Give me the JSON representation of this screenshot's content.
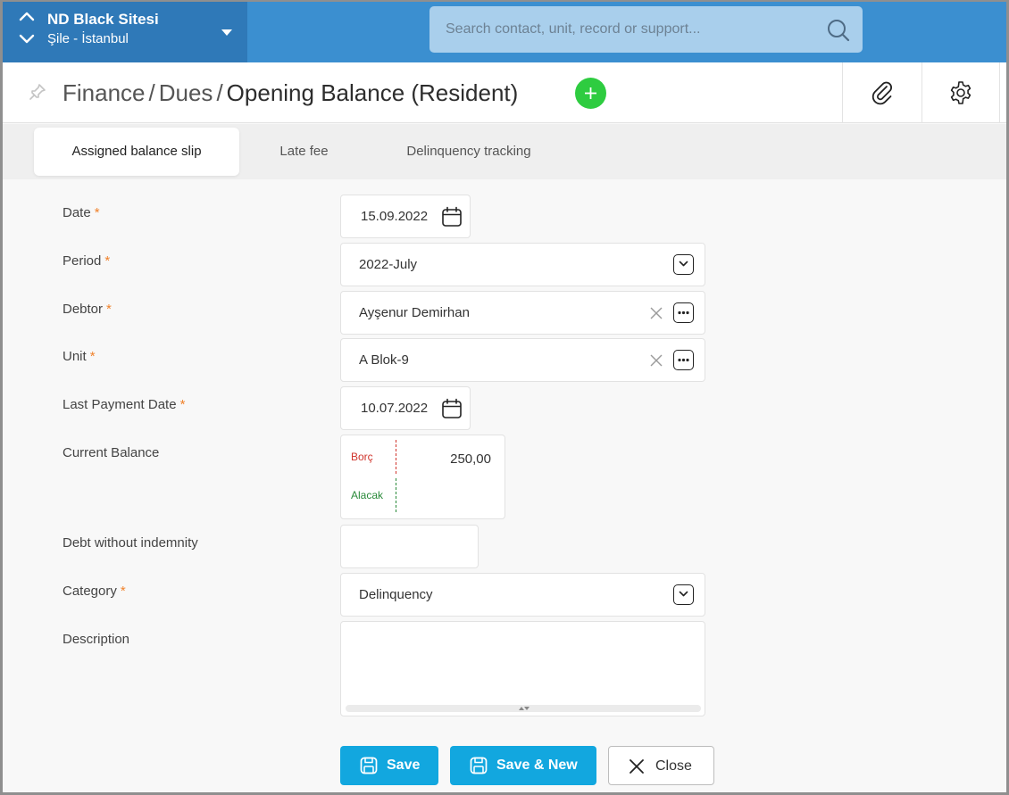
{
  "header": {
    "site_name": "ND Black Sitesi",
    "site_location": "Şile - İstanbul",
    "search_placeholder": "Search contact, unit, record or support..."
  },
  "titlebar": {
    "breadcrumb": [
      "Finance",
      "Dues"
    ],
    "current": "Opening Balance (Resident)"
  },
  "tabs": [
    {
      "label": "Assigned balance slip",
      "active": true
    },
    {
      "label": "Late fee",
      "active": false
    },
    {
      "label": "Delinquency tracking",
      "active": false
    }
  ],
  "form": {
    "date": {
      "label": "Date",
      "required": "*",
      "value": "15.09.2022"
    },
    "period": {
      "label": "Period",
      "required": "*",
      "value": "2022-July"
    },
    "debtor": {
      "label": "Debtor",
      "required": "*",
      "value": "Ayşenur Demirhan"
    },
    "unit": {
      "label": "Unit",
      "required": "*",
      "value": "A Blok-9"
    },
    "last_payment_date": {
      "label": "Last Payment Date",
      "required": "*",
      "value": "10.07.2022"
    },
    "current_balance": {
      "label": "Current Balance",
      "debt_label": "Borç",
      "credit_label": "Alacak",
      "debt_value": "250,00",
      "credit_value": ""
    },
    "debt_without_indemnity": {
      "label": "Debt without indemnity",
      "value": ""
    },
    "category": {
      "label": "Category",
      "required": "*",
      "value": "Delinquency"
    },
    "description": {
      "label": "Description",
      "value": ""
    }
  },
  "buttons": {
    "save": "Save",
    "save_new": "Save & New",
    "close": "Close"
  },
  "colors": {
    "header_bg": "#3b8fd0",
    "site_box_bg": "#2f79b8",
    "primary_button": "#12a7df",
    "add_button": "#2ecc40",
    "required_mark": "#f0822c",
    "debt_red": "#d0342c",
    "credit_green": "#2a8a3a"
  }
}
